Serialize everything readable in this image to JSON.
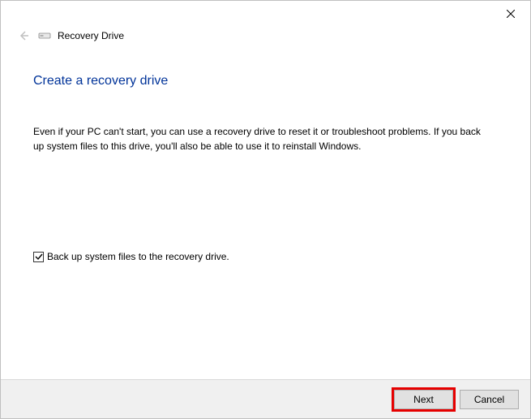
{
  "window": {
    "title": "Recovery Drive"
  },
  "content": {
    "heading": "Create a recovery drive",
    "description": "Even if your PC can't start, you can use a recovery drive to reset it or troubleshoot problems. If you back up system files to this drive, you'll also be able to use it to reinstall Windows."
  },
  "checkbox": {
    "label": "Back up system files to the recovery drive.",
    "checked": true
  },
  "buttons": {
    "next": "Next",
    "cancel": "Cancel"
  }
}
